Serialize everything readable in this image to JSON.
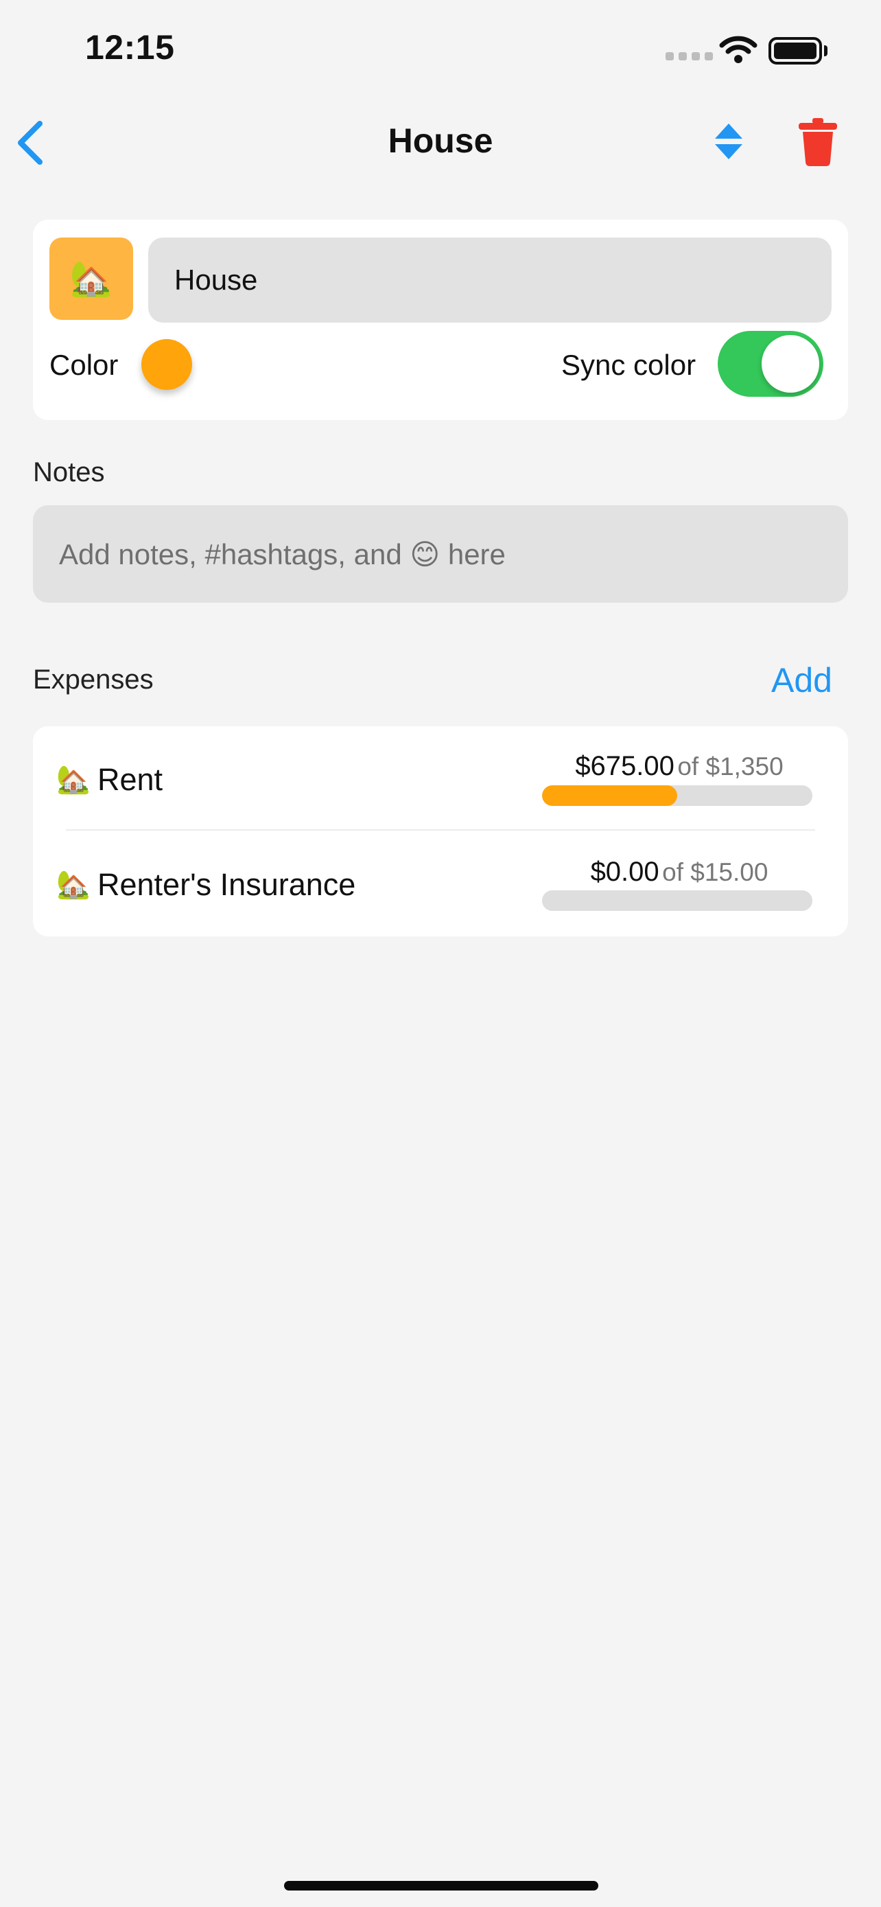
{
  "status_bar": {
    "time": "12:15"
  },
  "nav": {
    "title": "House"
  },
  "category": {
    "emoji": "🏡",
    "name_value": "House",
    "color_label": "Color",
    "color_hex": "#ffa40a",
    "sync_color_label": "Sync color",
    "sync_color_on": true
  },
  "notes": {
    "label": "Notes",
    "placeholder": "Add notes, #hashtags, and 😊 here"
  },
  "expenses": {
    "label": "Expenses",
    "add_label": "Add",
    "items": [
      {
        "emoji": "🏡",
        "name": "Rent",
        "spent": "$675.00",
        "of_text": "of $1,350",
        "progress": 0.5
      },
      {
        "emoji": "🏡",
        "name": "Renter's Insurance",
        "spent": "$0.00",
        "of_text": "of $15.00",
        "progress": 0.0
      }
    ]
  },
  "colors": {
    "accent": "#2196f3",
    "danger": "#f0392b",
    "toggle_on": "#34c759",
    "category": "#ffa40a"
  }
}
